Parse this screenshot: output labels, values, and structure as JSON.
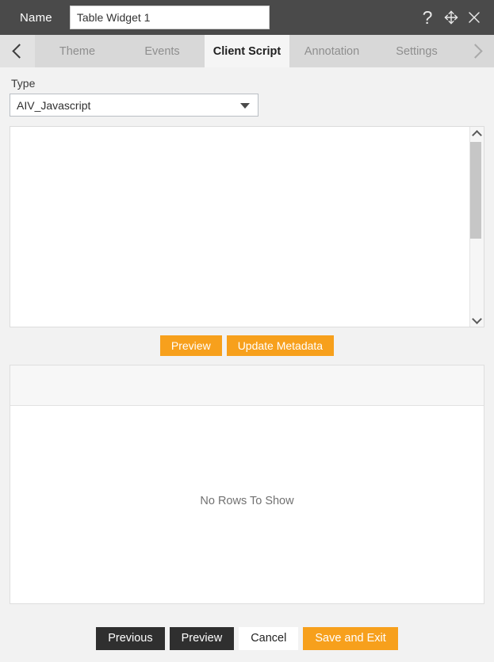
{
  "titlebar": {
    "name_label": "Name",
    "widget_name_value": "Table Widget 1",
    "widget_name_placeholder": "",
    "help_icon": "question-mark-icon",
    "move_icon": "move-arrows-icon",
    "close_icon": "close-x-icon"
  },
  "tabbar": {
    "prev_icon": "chevron-left-icon",
    "next_icon": "chevron-right-icon",
    "tabs": [
      {
        "label": "Theme",
        "active": false
      },
      {
        "label": "Events",
        "active": false
      },
      {
        "label": "Client Script",
        "active": true
      },
      {
        "label": "Annotation",
        "active": false
      },
      {
        "label": "Settings",
        "active": false
      }
    ]
  },
  "form": {
    "type_label": "Type",
    "type_value": "AIV_Javascript",
    "type_options": [
      "AIV_Javascript"
    ],
    "dropdown_icon": "chevron-down-icon"
  },
  "editor": {
    "script_value": "",
    "script_placeholder": "",
    "scroll_up_icon": "scroll-up-arrow-icon",
    "scroll_down_icon": "scroll-down-arrow-icon"
  },
  "actions": {
    "preview_label": "Preview",
    "update_metadata_label": "Update Metadata"
  },
  "grid": {
    "empty_message": "No Rows To Show",
    "columns": [],
    "rows": []
  },
  "footer": {
    "previous_label": "Previous",
    "preview_label": "Preview",
    "cancel_label": "Cancel",
    "save_exit_label": "Save and Exit"
  },
  "colors": {
    "titlebar_bg": "#4a4a4a",
    "tabbar_bg": "#d8d8d8",
    "active_tab_bg": "#f5f5f5",
    "accent_orange": "#f7a01c",
    "dark_button": "#2f2f2f",
    "page_bg": "#f2f2f2"
  }
}
